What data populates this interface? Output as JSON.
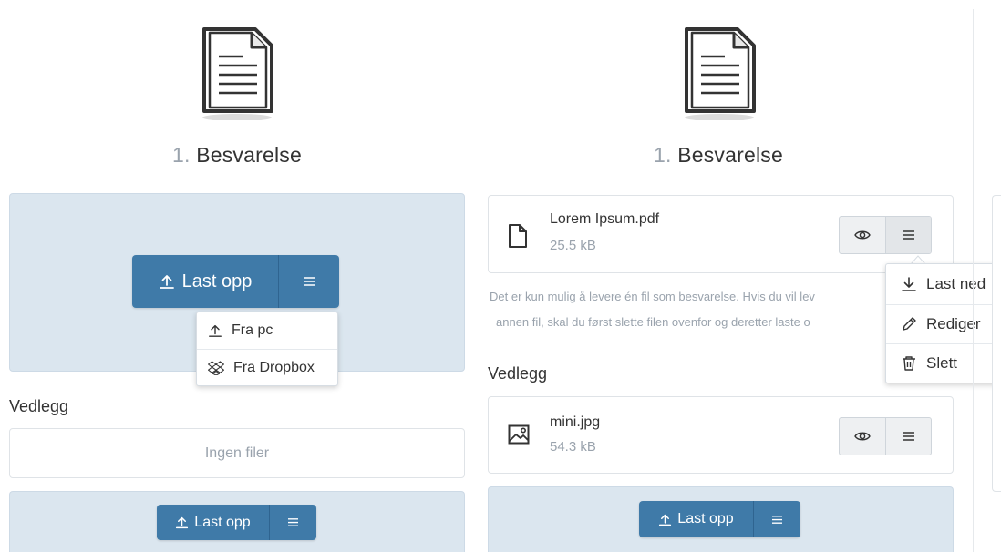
{
  "columns": [
    {
      "heading_num": "1.",
      "heading_text": "Besvarelse",
      "upload_label": "Last opp",
      "dropdown": [
        {
          "icon": "upload-icon",
          "label": "Fra pc"
        },
        {
          "icon": "dropbox-icon",
          "label": "Fra Dropbox"
        }
      ],
      "vedlegg_label": "Vedlegg",
      "empty_text": "Ingen filer",
      "vedlegg_upload_label": "Last opp"
    },
    {
      "heading_num": "1.",
      "heading_text": "Besvarelse",
      "file": {
        "name": "Lorem Ipsum.pdf",
        "size": "25.5 kB",
        "icon": "file-icon"
      },
      "info_line1": "Det er kun mulig å levere én fil som besvarelse. Hvis du vil lev",
      "info_line2": "annen fil, skal du først slette filen ovenfor og deretter laste o",
      "file_menu": [
        {
          "icon": "download-icon",
          "label": "Last ned"
        },
        {
          "icon": "pencil-icon",
          "label": "Rediger"
        },
        {
          "icon": "trash-icon",
          "label": "Slett"
        }
      ],
      "vedlegg_label": "Vedlegg",
      "attachment": {
        "name": "mini.jpg",
        "size": "54.3 kB",
        "icon": "image-icon"
      },
      "vedlegg_upload_label": "Last opp"
    }
  ],
  "colors": {
    "primary_button": "#3f7aa8",
    "dropzone": "#dbe6ef",
    "muted_text": "#9aa3ad"
  }
}
